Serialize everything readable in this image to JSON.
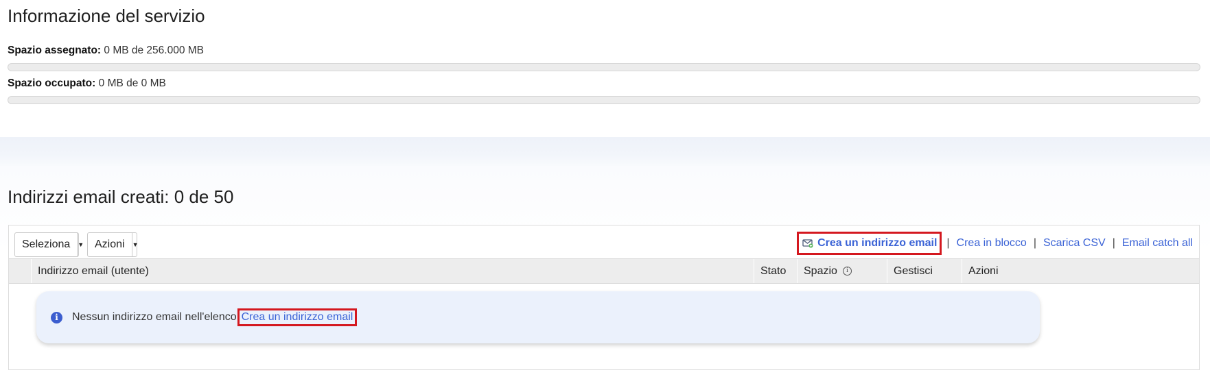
{
  "service": {
    "title": "Informazione del servizio",
    "assigned_label": "Spazio assegnato:",
    "assigned_value": "0 MB de 256.000 MB",
    "assigned_fill_fraction": 0,
    "used_label": "Spazio occupato:",
    "used_value": "0 MB de 0 MB",
    "used_fill_fraction": 0
  },
  "addresses": {
    "title": "Indirizzi email creati: 0 de 50",
    "toolbar": {
      "select_label": "Seleziona",
      "actions_label": "Azioni",
      "create_label": "Crea un indirizzo email",
      "bulk_label": "Crea in blocco",
      "csv_label": "Scarica CSV",
      "catchall_label": "Email catch all",
      "separator": "|"
    },
    "columns": {
      "email": "Indirizzo email (utente)",
      "status": "Stato",
      "space": "Spazio",
      "manage": "Gestisci",
      "actions": "Azioni"
    },
    "empty": {
      "message": "Nessun indirizzo email nell'elenco",
      "link": "Crea un indirizzo email"
    }
  },
  "icons": {
    "create": "mail-plus-icon",
    "space_info": "info-circle-icon",
    "notice": "info-filled-icon",
    "dropdown": "caret-down-icon"
  },
  "colors": {
    "link": "#3b63d6",
    "highlight": "#d4181f",
    "notice_bg": "#ebf1fc",
    "header_bg": "#ededed"
  }
}
